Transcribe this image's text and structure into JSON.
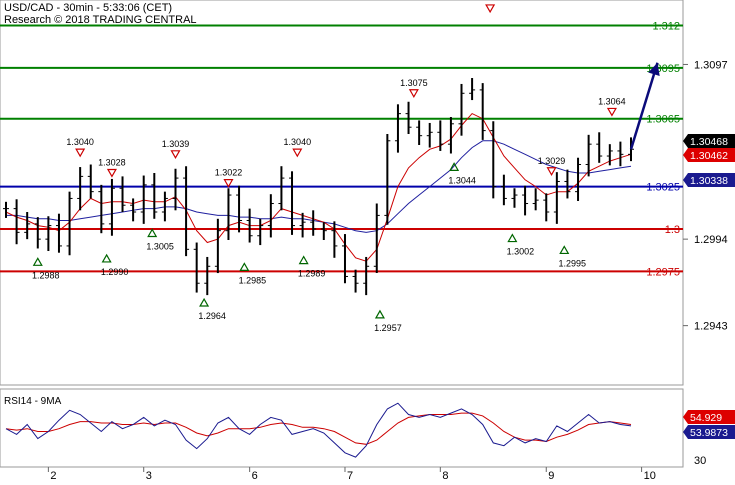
{
  "header": {
    "title": "USD/CAD - 30min - 5:33:06 (CET)",
    "copyright": "Research © 2018 TRADING CENTRAL"
  },
  "colors": {
    "background": "#ffffff",
    "price": "#000000",
    "ma_short": "#cc0000",
    "ma_long": "#1f1f9f",
    "resistance": "#008000",
    "support": "#cc0000",
    "pivot": "#0000aa",
    "forecast_arrow": "#0b0b7a",
    "peak_marker": "#cc0000",
    "trough_marker": "#006600",
    "rsi": "#1a1a8f",
    "rsi_ma": "#cc0000"
  },
  "chart_data": [
    {
      "type": "line",
      "name": "price",
      "ylim": [
        1.2908,
        1.3135
      ],
      "y_ticks": [
        "1.3097",
        "1.2994",
        "1.2943"
      ],
      "x_ticks": [
        "2",
        "3",
        "6",
        "7",
        "8",
        "9",
        "10"
      ],
      "x_tick_index": [
        4,
        13,
        23,
        32,
        41,
        51,
        60
      ],
      "closes": [
        1.3012,
        1.2998,
        1.3003,
        1.2994,
        1.3002,
        1.299,
        1.3018,
        1.3031,
        1.3022,
        1.3003,
        1.3024,
        1.3014,
        1.301,
        1.3026,
        1.301,
        1.3018,
        1.303,
        1.2988,
        1.2968,
        1.2978,
        1.2999,
        1.302,
        1.3005,
        1.2996,
        1.3002,
        1.3015,
        1.303,
        1.3002,
        1.3004,
        1.3,
        1.2999,
        1.299,
        1.2972,
        1.2968,
        1.2978,
        1.3008,
        1.3052,
        1.3068,
        1.306,
        1.3055,
        1.3057,
        1.305,
        1.3062,
        1.308,
        1.3082,
        1.3058,
        1.3025,
        1.3018,
        1.302,
        1.3015,
        1.3017,
        1.301,
        1.3028,
        1.3022,
        1.3038,
        1.305,
        1.3043,
        1.3046,
        1.3044,
        1.3047
      ],
      "ma_short": [
        1.301,
        1.3007,
        1.3005,
        1.3002,
        1.3001,
        1.2999,
        1.3004,
        1.3012,
        1.3018,
        1.3015,
        1.3016,
        1.3016,
        1.3015,
        1.3017,
        1.3016,
        1.3016,
        1.3019,
        1.3011,
        1.2999,
        1.2992,
        1.2994,
        1.3002,
        1.3004,
        1.3002,
        1.3002,
        1.3005,
        1.3012,
        1.301,
        1.3008,
        1.3006,
        1.3004,
        1.3,
        1.2991,
        1.2983,
        1.2981,
        1.2988,
        1.3006,
        1.3025,
        1.3036,
        1.3042,
        1.3047,
        1.3049,
        1.3053,
        1.3061,
        1.3068,
        1.3065,
        1.3054,
        1.3043,
        1.3036,
        1.3029,
        1.3025,
        1.302,
        1.3022,
        1.3022,
        1.3027,
        1.3034,
        1.3037,
        1.304,
        1.3042,
        1.3044
      ],
      "ma_long": [
        1.3008,
        1.3008,
        1.3007,
        1.3006,
        1.3006,
        1.3005,
        1.3005,
        1.3006,
        1.3007,
        1.3008,
        1.3009,
        1.301,
        1.3011,
        1.3012,
        1.3012,
        1.3013,
        1.3013,
        1.3012,
        1.301,
        1.3009,
        1.3008,
        1.3008,
        1.3007,
        1.3007,
        1.3006,
        1.3006,
        1.3007,
        1.3006,
        1.3006,
        1.3005,
        1.3004,
        1.3003,
        1.3001,
        1.2999,
        1.2998,
        1.2999,
        1.3003,
        1.3009,
        1.3015,
        1.302,
        1.3025,
        1.303,
        1.3035,
        1.3042,
        1.3048,
        1.3052,
        1.3052,
        1.305,
        1.3047,
        1.3044,
        1.3041,
        1.3038,
        1.3036,
        1.3034,
        1.3033,
        1.3033,
        1.3034,
        1.3035,
        1.3036,
        1.3037
      ],
      "forecast": [
        {
          "index": 59,
          "value": 1.3047
        },
        {
          "index": 61.5,
          "value": 1.3098
        }
      ],
      "levels": [
        {
          "value": 1.312,
          "label": "1.312",
          "kind": "resistance"
        },
        {
          "value": 1.3095,
          "label": "1.3095",
          "kind": "resistance"
        },
        {
          "value": 1.3065,
          "label": "1.3065",
          "kind": "resistance"
        },
        {
          "value": 1.3025,
          "label": "1.3025",
          "kind": "pivot"
        },
        {
          "value": 1.3,
          "label": "1.3",
          "kind": "support"
        },
        {
          "value": 1.2975,
          "label": "1.2975",
          "kind": "support"
        }
      ],
      "peaks": [
        {
          "index": 7,
          "value": 1.304,
          "label": "1.3040"
        },
        {
          "index": 10,
          "value": 1.3028,
          "label": "1.3028"
        },
        {
          "index": 16,
          "value": 1.3039,
          "label": "1.3039"
        },
        {
          "index": 21,
          "value": 1.3022,
          "label": "1.3022"
        },
        {
          "index": 27.5,
          "value": 1.304,
          "label": "1.3040"
        },
        {
          "index": 38.5,
          "value": 1.3075,
          "label": "1.3075"
        },
        {
          "index": 45.7,
          "value": 1.3125,
          "label": ""
        },
        {
          "index": 51.5,
          "value": 1.3029,
          "label": "1.3029"
        },
        {
          "index": 57.2,
          "value": 1.3064,
          "label": "1.3064"
        }
      ],
      "troughs": [
        {
          "index": 3,
          "value": 1.2988,
          "label": "1.2988"
        },
        {
          "index": 9.5,
          "value": 1.299,
          "label": "1.2990"
        },
        {
          "index": 13.8,
          "value": 1.3005,
          "label": "1.3005"
        },
        {
          "index": 18.7,
          "value": 1.2964,
          "label": "1.2964"
        },
        {
          "index": 22.5,
          "value": 1.2985,
          "label": "1.2985"
        },
        {
          "index": 28.1,
          "value": 1.2989,
          "label": "1.2989"
        },
        {
          "index": 35.3,
          "value": 1.2957,
          "label": "1.2957"
        },
        {
          "index": 42.3,
          "value": 1.3044,
          "label": "1.3044"
        },
        {
          "index": 47.8,
          "value": 1.3002,
          "label": "1.3002"
        },
        {
          "index": 52.7,
          "value": 1.2995,
          "label": "1.2995"
        }
      ],
      "price_badges": [
        {
          "value": 1.30468,
          "label": "1.30468",
          "kind": "last"
        },
        {
          "value": 1.30462,
          "label": "1.30462",
          "kind": "ma_short"
        },
        {
          "value": 1.30338,
          "label": "1.30338",
          "kind": "ma_long"
        }
      ]
    },
    {
      "type": "line",
      "name": "RSI14",
      "title": "RSI14 - 9MA",
      "ylim": [
        25,
        80
      ],
      "y_ticks": [
        "30"
      ],
      "rsi": [
        52,
        48,
        55,
        45,
        50,
        58,
        65,
        62,
        56,
        50,
        57,
        52,
        55,
        60,
        54,
        58,
        55,
        44,
        38,
        45,
        56,
        60,
        52,
        48,
        55,
        60,
        58,
        48,
        50,
        52,
        49,
        42,
        35,
        32,
        40,
        55,
        66,
        70,
        62,
        60,
        62,
        60,
        63,
        66,
        62,
        55,
        42,
        40,
        46,
        42,
        45,
        43,
        54,
        50,
        56,
        62,
        56,
        57,
        55,
        54
      ],
      "rsi_ma": [
        52,
        51,
        52,
        50,
        50,
        52,
        55,
        57,
        57,
        56,
        56,
        55,
        55,
        56,
        55,
        56,
        56,
        53,
        49,
        47,
        49,
        52,
        52,
        52,
        53,
        55,
        56,
        55,
        53,
        53,
        52,
        50,
        46,
        42,
        41,
        44,
        50,
        56,
        60,
        61,
        62,
        62,
        62,
        63,
        63,
        61,
        56,
        50,
        46,
        44,
        44,
        43,
        46,
        48,
        51,
        55,
        56,
        57,
        56,
        55
      ],
      "badges": [
        {
          "value": 54.92,
          "label": "54.929",
          "kind": "rsi_ma"
        },
        {
          "value": 53.98,
          "label": "53.9873",
          "kind": "rsi"
        }
      ]
    }
  ]
}
